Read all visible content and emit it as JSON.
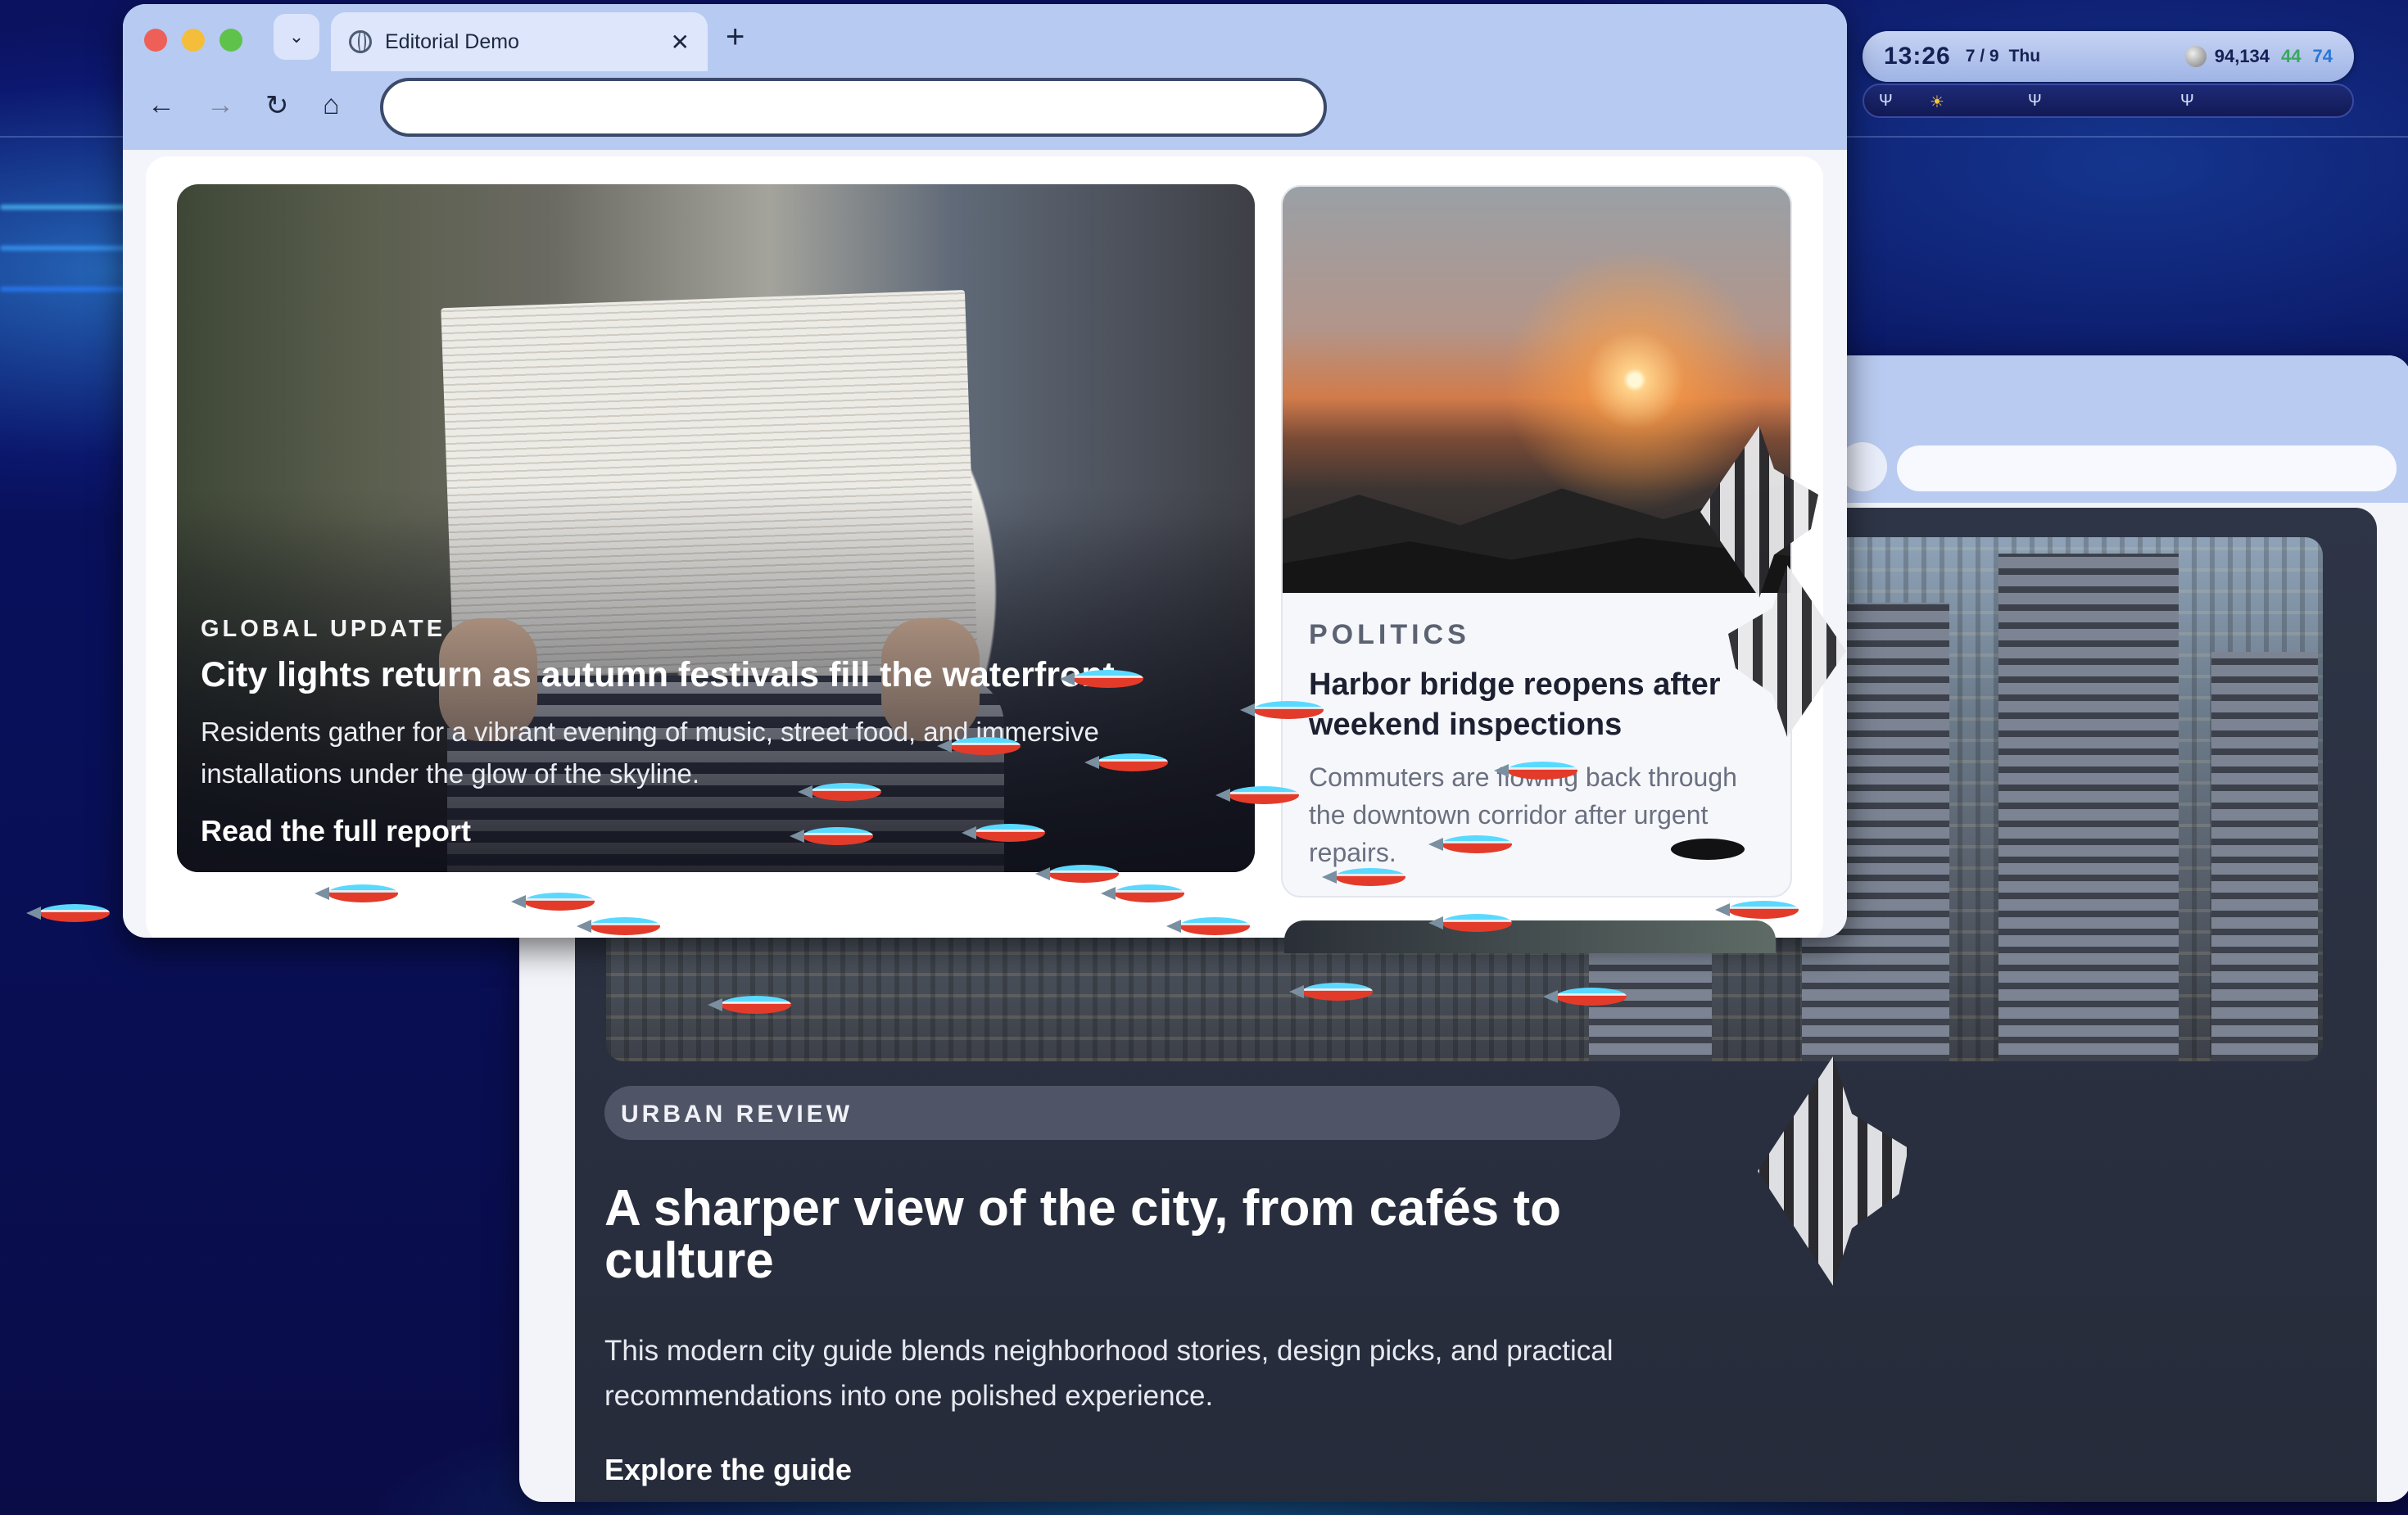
{
  "status_widget": {
    "time": "13:26",
    "date": "7 / 9",
    "weekday": "Thu",
    "count": "94,134",
    "stat_green": "44",
    "stat_blue": "74"
  },
  "browser": {
    "tab_title": "Editorial Demo",
    "new_tab_label": "+",
    "close_label": "✕",
    "address_value": "",
    "nav": {
      "back": "←",
      "forward": "→",
      "reload": "↻",
      "home": "⌂",
      "tab_menu": "⌄"
    }
  },
  "hero": {
    "kicker": "GLOBAL UPDATE",
    "title": "City lights return as autumn festivals fill the waterfront",
    "description": "Residents gather for a vibrant evening of music, street food, and immersive installations under the glow of the skyline.",
    "cta": "Read the full report"
  },
  "side_card": {
    "kicker": "POLITICS",
    "title": "Harbor bridge reopens after weekend inspections",
    "description": "Commuters are flowing back through the downtown corridor after urgent repairs."
  },
  "back_window": {
    "kicker": "URBAN REVIEW",
    "title": "A sharper view of the city, from cafés to culture",
    "description": "This modern city guide blends neighborhood stories, design picks, and practical recommendations into one polished experience.",
    "cta": "Explore the guide"
  },
  "colors": {
    "chrome": "#b7caf1",
    "desktop": "#0a0e4a",
    "dark_card": "#2e3546",
    "traffic_red": "#ee5f57",
    "traffic_yellow": "#f5be3a",
    "traffic_green": "#5fc24b"
  },
  "icons": [
    "globe-icon",
    "close-icon",
    "plus-icon",
    "back-arrow-icon",
    "forward-arrow-icon",
    "reload-icon",
    "home-icon",
    "chevron-down-icon",
    "moon-icon"
  ]
}
